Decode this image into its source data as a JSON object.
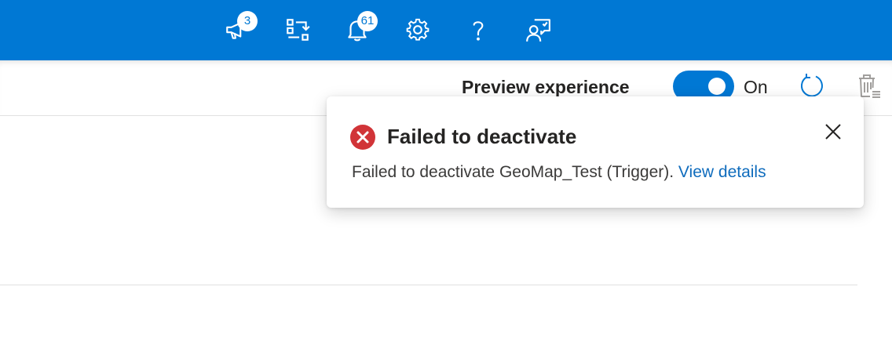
{
  "header": {
    "icons": [
      {
        "name": "whats-new-megaphone-icon",
        "badge": "3"
      },
      {
        "name": "switch-directory-icon",
        "badge": null
      },
      {
        "name": "notifications-bell-icon",
        "badge": "61"
      },
      {
        "name": "settings-gear-icon",
        "badge": null
      },
      {
        "name": "help-question-icon",
        "badge": null
      },
      {
        "name": "feedback-person-icon",
        "badge": null
      }
    ]
  },
  "command_bar": {
    "preview_label": "Preview experience",
    "toggle_state": "On",
    "toggle_on": true
  },
  "notification": {
    "status": "error",
    "title": "Failed to deactivate",
    "message": "Failed to deactivate GeoMap_Test (Trigger).",
    "link_text": "View details"
  },
  "colors": {
    "brand": "#0078d4",
    "error": "#d13438",
    "link": "#0f6cbd"
  }
}
